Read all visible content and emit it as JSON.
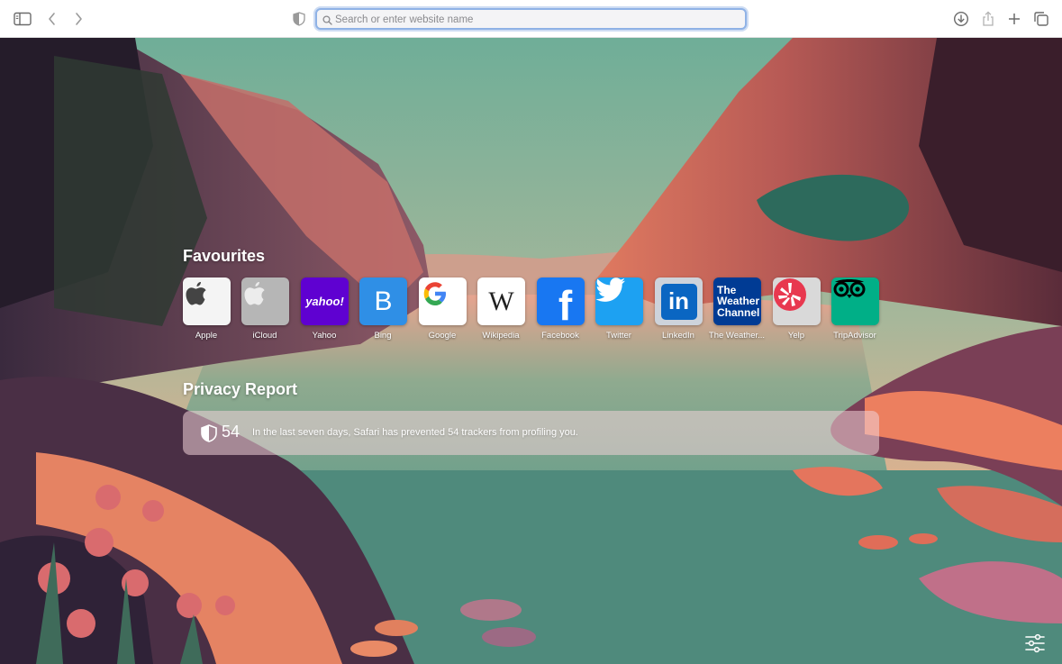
{
  "toolbar": {
    "address_placeholder": "Search or enter website name",
    "address_value": ""
  },
  "icons": {
    "sidebar": "sidebar-icon",
    "back": "chevron-left-icon",
    "forward": "chevron-right-icon",
    "privacy": "shield-icon",
    "search": "search-icon",
    "downloads": "download-icon",
    "share": "share-icon",
    "new_tab": "plus-icon",
    "tab_overview": "tabs-icon",
    "customize": "sliders-icon"
  },
  "favourites": {
    "title": "Favourites",
    "items": [
      {
        "label": "Apple",
        "icon": "apple-logo-icon",
        "bg": "#f4f4f4"
      },
      {
        "label": "iCloud",
        "icon": "apple-logo-icon",
        "bg": "#b6b6b6"
      },
      {
        "label": "Yahoo",
        "icon": "yahoo-logo",
        "text": "yahoo!",
        "bg": "#5f01d1"
      },
      {
        "label": "Bing",
        "icon": "bing-logo",
        "text": "B",
        "bg": "#2f8fe6"
      },
      {
        "label": "Google",
        "icon": "google-logo",
        "text": "G",
        "bg": "#ffffff"
      },
      {
        "label": "Wikipedia",
        "icon": "wikipedia-logo",
        "text": "W",
        "bg": "#ffffff"
      },
      {
        "label": "Facebook",
        "icon": "facebook-logo",
        "text": "f",
        "bg": "#1877f2"
      },
      {
        "label": "Twitter",
        "icon": "twitter-bird-icon",
        "bg": "#1da1f2"
      },
      {
        "label": "LinkedIn",
        "icon": "linkedin-logo",
        "text": "in",
        "bg": "#0a66c2"
      },
      {
        "label": "The Weather...",
        "icon": "weather-channel-logo",
        "text": "The Weather Channel",
        "bg": "#003b94"
      },
      {
        "label": "Yelp",
        "icon": "yelp-logo",
        "bg": "#d9d9d9"
      },
      {
        "label": "TripAdvisor",
        "icon": "tripadvisor-owl-icon",
        "bg": "#00af87"
      }
    ]
  },
  "privacy_report": {
    "title": "Privacy Report",
    "count": "54",
    "message": "In the last seven days, Safari has prevented 54 trackers from profiling you."
  },
  "colors": {
    "accent": "#8fb2e6",
    "sky_top": "#7fb89c",
    "sky_bottom": "#f0a68a"
  }
}
